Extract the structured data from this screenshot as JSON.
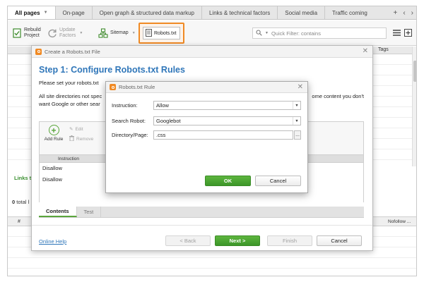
{
  "tabs": [
    {
      "label": "All pages",
      "active": true
    },
    {
      "label": "On-page"
    },
    {
      "label": "Open graph & structured data markup"
    },
    {
      "label": "Links & technical factors"
    },
    {
      "label": "Social media"
    },
    {
      "label": "Traffic coming"
    }
  ],
  "tab_controls": {
    "add": "+",
    "prev": "‹",
    "next": "›"
  },
  "toolbar": {
    "rebuild": "Rebuild\nProject",
    "update": "Update\nFactors",
    "sitemap": "Sitemap",
    "robots": "Robots.txt",
    "filter_placeholder": "Quick Filter: contains"
  },
  "grid": {
    "tags_header": "Tags",
    "links_label": "Links t",
    "total_count": "0",
    "total_label": "total l",
    "hash_header": "#",
    "nofollow_header": "Nofollow ..."
  },
  "dialog": {
    "title": "Create a Robots.txt File",
    "step_title": "Step 1: Configure Robots.txt Rules",
    "desc1": "Please set your robots.txt",
    "desc2_left": "All site directories not spec",
    "desc2_right": "ome content you don't",
    "desc2_line2": "want Google or other sear",
    "add_rule": "Add Rule",
    "edit": "Edit",
    "remove": "Remove",
    "col_instruction": "Instruction",
    "rules": [
      "Disallow",
      "Disallow"
    ],
    "content_tabs": [
      "Contents",
      "Test"
    ],
    "online_help": "Online Help",
    "back": "< Back",
    "next": "Next >",
    "finish": "Finish",
    "cancel": "Cancel"
  },
  "rule_dialog": {
    "title": "Robots.txt Rule",
    "instruction_label": "Instruction:",
    "instruction_value": "Allow",
    "robot_label": "Search Robot:",
    "robot_value": "Googlebot",
    "dir_label": "Directory/Page:",
    "dir_value": ".css",
    "browse": "...",
    "ok": "OK",
    "cancel": "Cancel"
  },
  "colors": {
    "accent_blue": "#2f76b9",
    "highlight_orange": "#f08a24",
    "green": "#5aa63c"
  }
}
